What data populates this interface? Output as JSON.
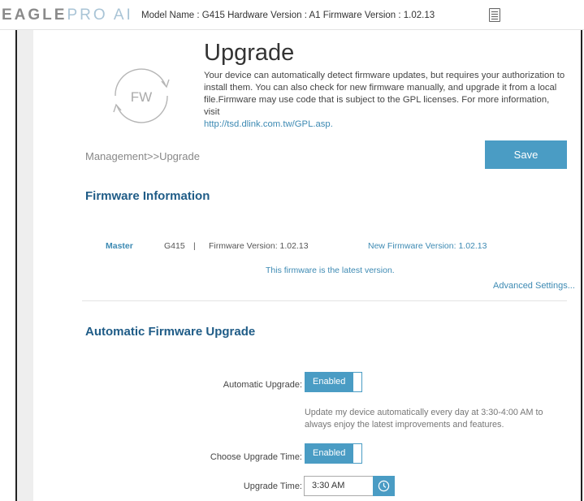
{
  "header": {
    "logo_brand": "EAGLE",
    "logo_sub": "PRO AI",
    "model_info": "Model Name : G415 Hardware Version : A1 Firmware Version : 1.02.13",
    "doc_icon": "document-icon"
  },
  "page": {
    "icon_label": "FW",
    "title": "Upgrade",
    "description": "Your device can automatically detect firmware updates, but requires your authorization to install them. You can also check for new firmware manually, and upgrade it from a local file.Firmware may use code that is subject to the GPL licenses. For more information, visit",
    "gpl_link": "http://tsd.dlink.com.tw/GPL.asp.",
    "breadcrumb": "Management>>Upgrade",
    "save_label": "Save"
  },
  "firmware_info": {
    "heading": "Firmware Information",
    "master_label": "Master",
    "device": "G415",
    "separator": "|",
    "current_version": "Firmware Version: 1.02.13",
    "new_version": "New Firmware Version: 1.02.13",
    "status": "This firmware is the latest version.",
    "advanced_link": "Advanced Settings..."
  },
  "auto_upgrade": {
    "heading": "Automatic Firmware Upgrade",
    "auto_label": "Automatic Upgrade:",
    "auto_state": "Enabled",
    "help_text": "Update my device automatically every day at 3:30-4:00 AM to always enjoy the latest improvements and features.",
    "choose_label": "Choose Upgrade Time:",
    "choose_state": "Enabled",
    "time_label": "Upgrade Time:",
    "time_value": "3:30 AM",
    "time_icon": "clock-icon"
  },
  "colors": {
    "accent": "#4a9cc4",
    "heading": "#1f5c87",
    "link": "#3d8ab3"
  }
}
